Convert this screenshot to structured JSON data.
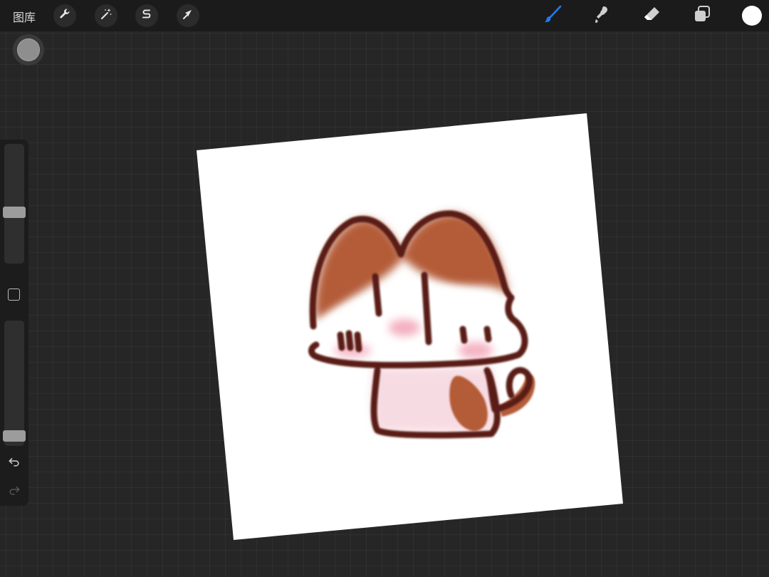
{
  "app": {
    "gallery_label": "图库"
  },
  "toolbar_left": [
    {
      "name": "wrench-icon",
      "label": "actions"
    },
    {
      "name": "magic-wand-icon",
      "label": "adjustments"
    },
    {
      "name": "selection-s-icon",
      "label": "selection"
    },
    {
      "name": "transform-arrow-icon",
      "label": "transform"
    }
  ],
  "toolbar_right": {
    "tools": [
      {
        "name": "brush-icon",
        "active": true
      },
      {
        "name": "smudge-icon",
        "active": false
      },
      {
        "name": "eraser-icon",
        "active": false
      },
      {
        "name": "layers-icon",
        "active": false
      }
    ],
    "current_color": "#ffffff"
  },
  "sidebar": {
    "brush_size_level": 0.42,
    "opacity_level": 0.04,
    "icons": [
      "eyedropper-square-icon",
      "undo-icon",
      "redo-icon"
    ]
  },
  "colors": {
    "accent": "#1f7cf2",
    "outline": "#5a1e12",
    "fur": "#b45b38",
    "blush": "#f5b8c4",
    "canvas_bg": "#262626"
  }
}
